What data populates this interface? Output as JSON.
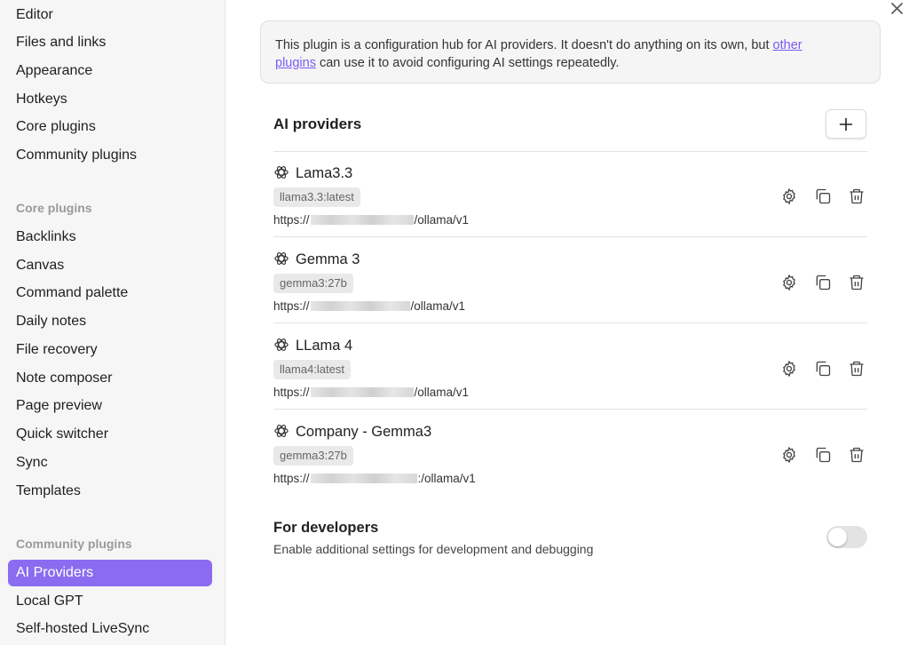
{
  "sidebar": {
    "options_items": [
      {
        "label": "Editor"
      },
      {
        "label": "Files and links"
      },
      {
        "label": "Appearance"
      },
      {
        "label": "Hotkeys"
      },
      {
        "label": "Core plugins"
      },
      {
        "label": "Community plugins"
      }
    ],
    "core_heading": "Core plugins",
    "core_items": [
      {
        "label": "Backlinks"
      },
      {
        "label": "Canvas"
      },
      {
        "label": "Command palette"
      },
      {
        "label": "Daily notes"
      },
      {
        "label": "File recovery"
      },
      {
        "label": "Note composer"
      },
      {
        "label": "Page preview"
      },
      {
        "label": "Quick switcher"
      },
      {
        "label": "Sync"
      },
      {
        "label": "Templates"
      }
    ],
    "community_heading": "Community plugins",
    "community_items": [
      {
        "label": "AI Providers",
        "active": true
      },
      {
        "label": "Local GPT"
      },
      {
        "label": "Self-hosted LiveSync"
      }
    ]
  },
  "info": {
    "text_before": "This plugin is a configuration hub for AI providers. It doesn't do anything on its own, but ",
    "link_part1": "other",
    "link_part2": "plugins",
    "text_after": " can use it to avoid configuring AI settings repeatedly."
  },
  "providers_heading": "AI providers",
  "providers": [
    {
      "name": "Lama3.3",
      "model": "llama3.3:latest",
      "url_prefix": "https://",
      "url_suffix": "/ollama/v1"
    },
    {
      "name": "Gemma 3",
      "model": "gemma3:27b",
      "url_prefix": "https://",
      "url_suffix": "/ollama/v1"
    },
    {
      "name": "LLama 4",
      "model": "llama4:latest",
      "url_prefix": "https://",
      "url_suffix": "/ollama/v1"
    },
    {
      "name": "Company - Gemma3",
      "model": "gemma3:27b",
      "url_prefix": "https://",
      "url_suffix": ":/ollama/v1"
    }
  ],
  "developers": {
    "title": "For developers",
    "description": "Enable additional settings for development and debugging",
    "enabled": false
  },
  "colors": {
    "accent": "#8b6cf0",
    "link": "#7a5af5",
    "sidebar_bg": "#f6f6f6"
  },
  "icons": {
    "close": "close-icon",
    "add": "plus-icon",
    "provider": "openai-logo-icon",
    "settings": "gear-icon",
    "duplicate": "copy-icon",
    "delete": "trash-icon"
  }
}
